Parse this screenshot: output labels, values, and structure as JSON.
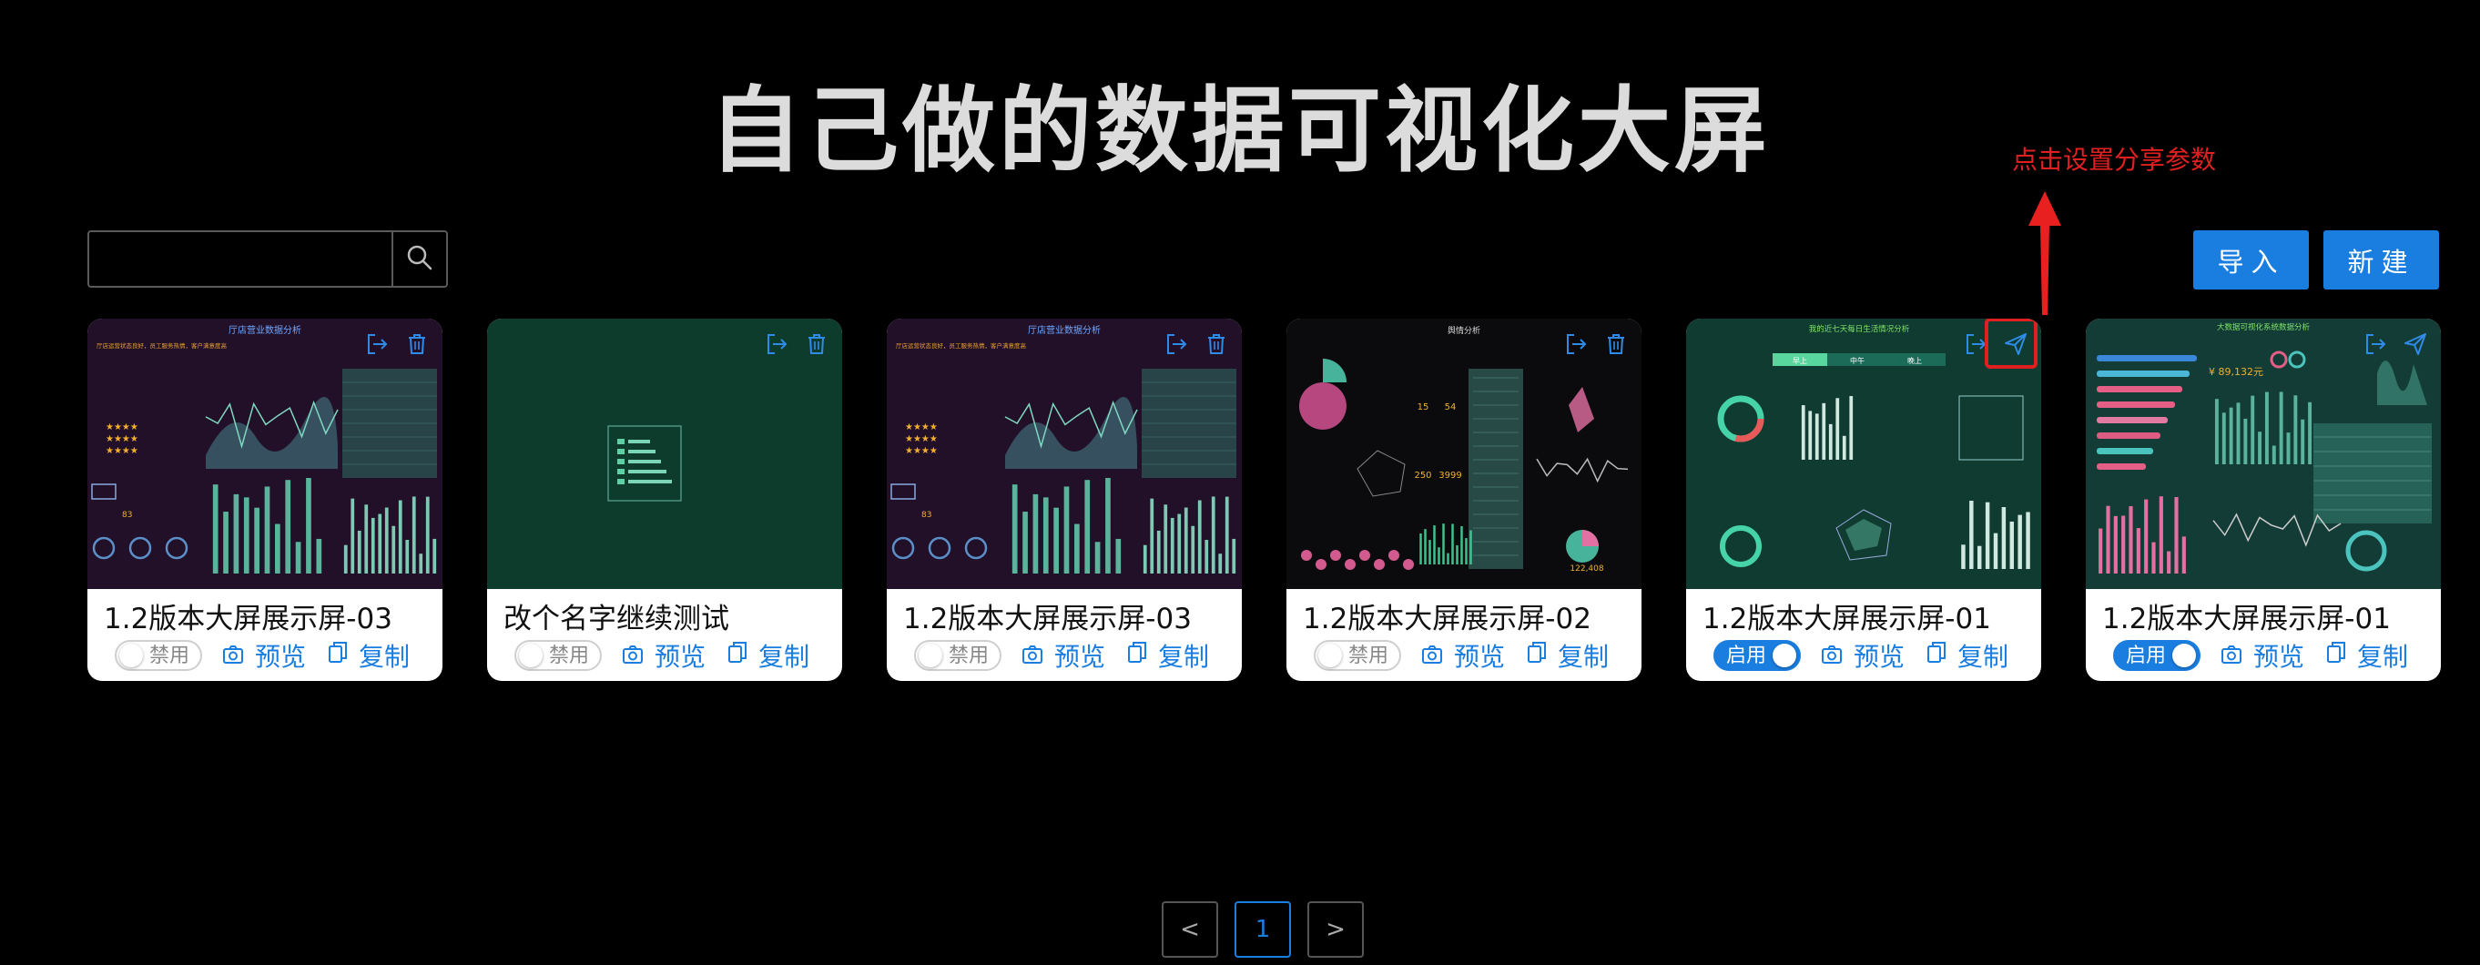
{
  "page": {
    "title": "自己做的数据可视化大屏"
  },
  "annotation": {
    "text": "点击设置分享参数",
    "color": "#e02020"
  },
  "search": {
    "value": "",
    "placeholder": "",
    "icon": "search-icon"
  },
  "toolbar": {
    "import_label": "导入",
    "new_label": "新建"
  },
  "card_labels": {
    "disabled": "禁用",
    "enabled": "启用",
    "preview": "预览",
    "copy": "复制"
  },
  "cards": [
    {
      "name": "1.2版本大屏展示屏-03",
      "status": "禁用",
      "enabled": false,
      "theme": "purple",
      "thumb_title": "厅店营业数据分析",
      "thumb_subtitle": "厅店运营状态良好，员工服务热情，客户满意度高"
    },
    {
      "name": "改个名字继续测试",
      "status": "禁用",
      "enabled": false,
      "theme": "blank"
    },
    {
      "name": "1.2版本大屏展示屏-03",
      "status": "禁用",
      "enabled": false,
      "theme": "purple",
      "thumb_title": "厅店营业数据分析",
      "thumb_subtitle": "厅店运营状态良好，员工服务热情，客户满意度高"
    },
    {
      "name": "1.2版本大屏展示屏-02",
      "status": "禁用",
      "enabled": false,
      "theme": "dark",
      "thumb_title": "舆情分析",
      "thumb_values": [
        "15",
        "54",
        "250",
        "3999",
        "122,408"
      ]
    },
    {
      "name": "1.2版本大屏展示屏-01",
      "status": "启用",
      "enabled": true,
      "theme": "green",
      "thumb_title": "我的近七天每日生活情况分析",
      "thumb_tabs": [
        "早上",
        "中午",
        "晚上"
      ],
      "highlight_share": true
    },
    {
      "name": "1.2版本大屏展示屏-01",
      "status": "启用",
      "enabled": true,
      "theme": "teal",
      "thumb_title": "大数据可视化系统数据分析",
      "thumb_amount": "¥ 89,132元"
    }
  ],
  "pagination": {
    "current": "1",
    "prev": "<",
    "next": ">"
  },
  "colors": {
    "accent": "#1a7ee0",
    "background": "#000000",
    "annotation": "#e02020"
  }
}
